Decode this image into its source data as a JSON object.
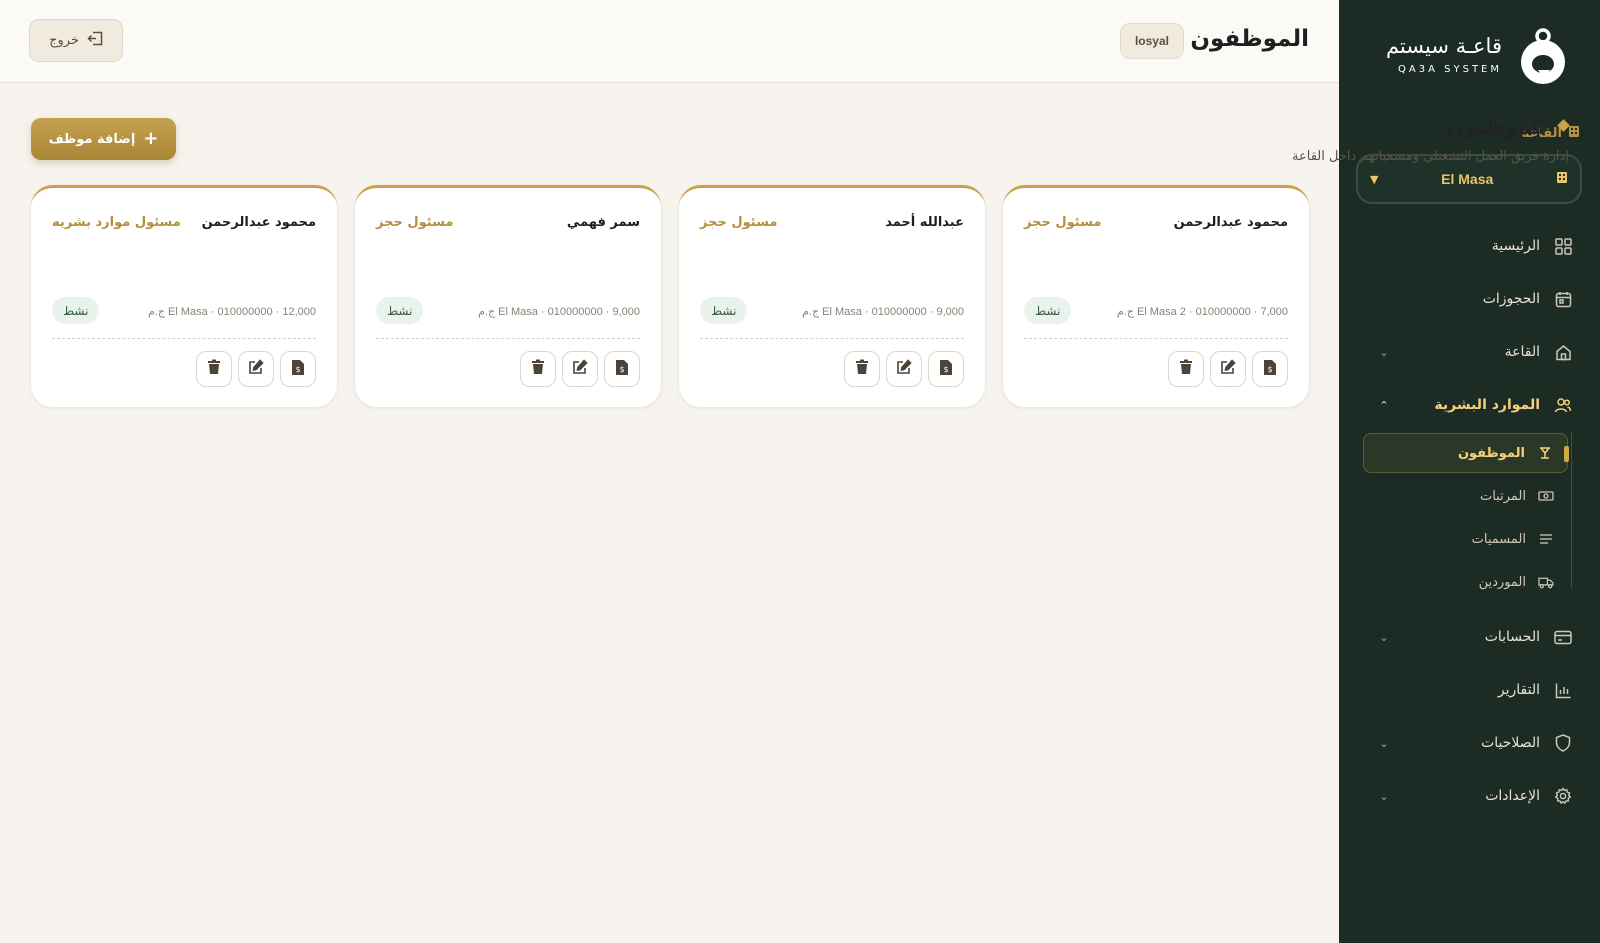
{
  "brand": {
    "name": "قاعـة سيستم",
    "sub": "QA3A SYSTEM"
  },
  "sidebar": {
    "hall_label": "القاعة",
    "hall_selected": "El Masa",
    "items": [
      {
        "label": "الرئيسية",
        "icon": "grid-icon"
      },
      {
        "label": "الحجوزات",
        "icon": "calendar-icon"
      },
      {
        "label": "القاعة",
        "icon": "home-icon"
      },
      {
        "label": "الموارد البشرية",
        "icon": "users-icon"
      },
      {
        "label": "الحسابات",
        "icon": "card-icon"
      },
      {
        "label": "التقارير",
        "icon": "chart-icon"
      },
      {
        "label": "الصلاحيات",
        "icon": "shield-icon"
      },
      {
        "label": "الإعدادات",
        "icon": "gear-icon"
      }
    ],
    "sub_items": [
      {
        "label": "الموظفون",
        "icon": "employees-icon"
      },
      {
        "label": "المرتبات",
        "icon": "money-icon"
      },
      {
        "label": "المسميات",
        "icon": "list-icon"
      },
      {
        "label": "الموردين",
        "icon": "truck-icon"
      }
    ]
  },
  "header": {
    "title": "الموظفون",
    "user": "losyal",
    "logout": "خروج"
  },
  "section": {
    "title": "الموظفون",
    "subtitle": "إدارة فريق العمل التشغيلي ومسمياتهم داخل القاعة",
    "add_button": "إضافة موظف"
  },
  "employees": [
    {
      "name": "محمود عبدالرحمن",
      "role": "مسئول حجز",
      "meta": "El Masa 2 · 010000000 · 7,000 ج.م",
      "status": "نشط"
    },
    {
      "name": "عبدالله أحمد",
      "role": "مسئول حجز",
      "meta": "El Masa · 010000000 · 9,000 ج.م",
      "status": "نشط"
    },
    {
      "name": "سمر فهمي",
      "role": "مسئول حجز",
      "meta": "El Masa · 010000000 · 9,000 ج.م",
      "status": "نشط"
    },
    {
      "name": "محمود عبدالرحمن",
      "role": "مسئول موارد بشريه",
      "meta": "El Masa · 010000000 · 12,000 ج.م",
      "status": "نشط"
    }
  ],
  "colors": {
    "sidebar_bg": "#1c2b24",
    "accent_gold": "#c9a24b",
    "page_bg": "#f7f4ef"
  }
}
